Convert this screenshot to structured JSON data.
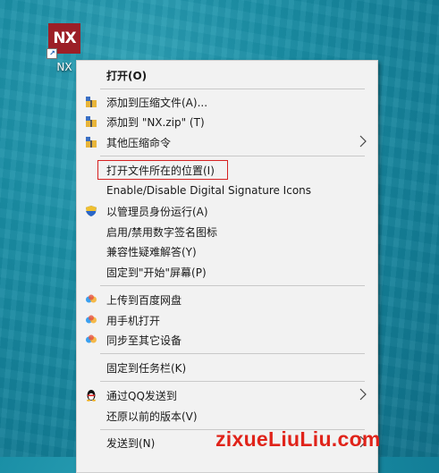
{
  "desktop_icon": {
    "tile_text": "NX",
    "label": "NX",
    "icon": "nx-shortcut-icon"
  },
  "menu": {
    "open": "打开(O)",
    "add_archive": "添加到压缩文件(A)...",
    "add_zip": "添加到 \"NX.zip\" (T)",
    "other_compress": "其他压缩命令",
    "open_location": "打开文件所在的位置(I)",
    "signature_icons_en": "Enable/Disable Digital Signature Icons",
    "run_as_admin": "以管理员身份运行(A)",
    "signature_icons_cn": "启用/禁用数字签名图标",
    "troubleshoot": "兼容性疑难解答(Y)",
    "pin_start": "固定到\"开始\"屏幕(P)",
    "upload_baidu": "上传到百度网盘",
    "open_phone": "用手机打开",
    "sync_device": "同步至其它设备",
    "pin_taskbar": "固定到任务栏(K)",
    "send_qq": "通过QQ发送到",
    "restore_version": "还原以前的版本(V)",
    "send_to": "发送到(N)"
  },
  "watermark": "zixueLiuLiu.com",
  "colors": {
    "highlight_border": "#d62020",
    "watermark": "#e0231a",
    "menu_bg": "#f2f2f2"
  }
}
